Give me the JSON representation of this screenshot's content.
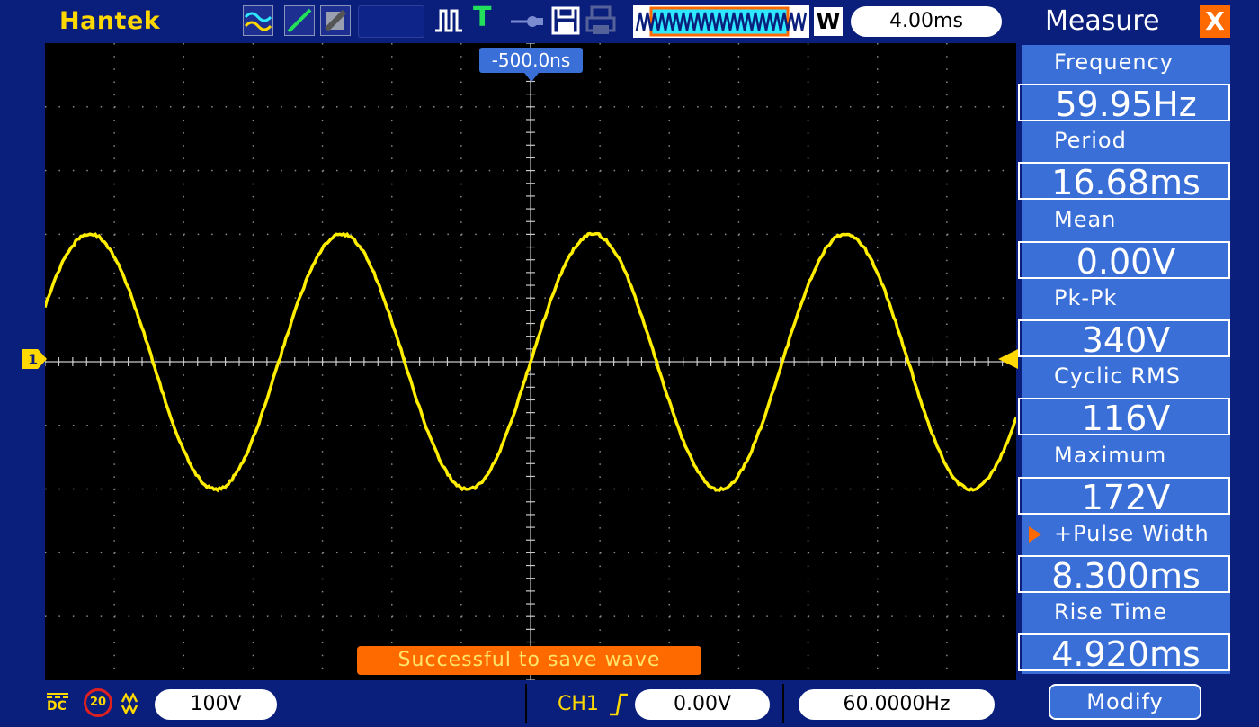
{
  "topbar": {
    "brand": "Hantek",
    "icons": [
      "wave-mode-icon",
      "line-mode-icon",
      "persist-mode-icon",
      "pulse-icon",
      "trigger-T-icon",
      "probe-icon",
      "save-icon",
      "print-icon",
      "waveform-zoom-icon"
    ],
    "trigger_letter": "T",
    "w_label": "W",
    "timebase": "4.00ms"
  },
  "screen": {
    "trigger_position": "-500.0ns",
    "ch1_marker": "1",
    "toast": "Successful to save wave",
    "trace_color": "#ffee00",
    "grid": true
  },
  "bottombar": {
    "coupling": "DC",
    "bandwidth": "20",
    "ch1_volts_div": "100V",
    "trigger_channel": "CH1",
    "trigger_level": "0.00V",
    "trigger_freq": "60.0000Hz"
  },
  "panel": {
    "title": "Measure",
    "close": "X",
    "measurements": [
      {
        "label": "Frequency",
        "value": "59.95Hz"
      },
      {
        "label": "Period",
        "value": "16.68ms"
      },
      {
        "label": "Mean",
        "value": "0.00V"
      },
      {
        "label": "Pk-Pk",
        "value": "340V"
      },
      {
        "label": "Cyclic RMS",
        "value": "116V"
      },
      {
        "label": "Maximum",
        "value": "172V"
      },
      {
        "label": "+Pulse Width",
        "value": "8.300ms"
      },
      {
        "label": "Rise Time",
        "value": "4.920ms"
      }
    ],
    "modify": "Modify"
  }
}
